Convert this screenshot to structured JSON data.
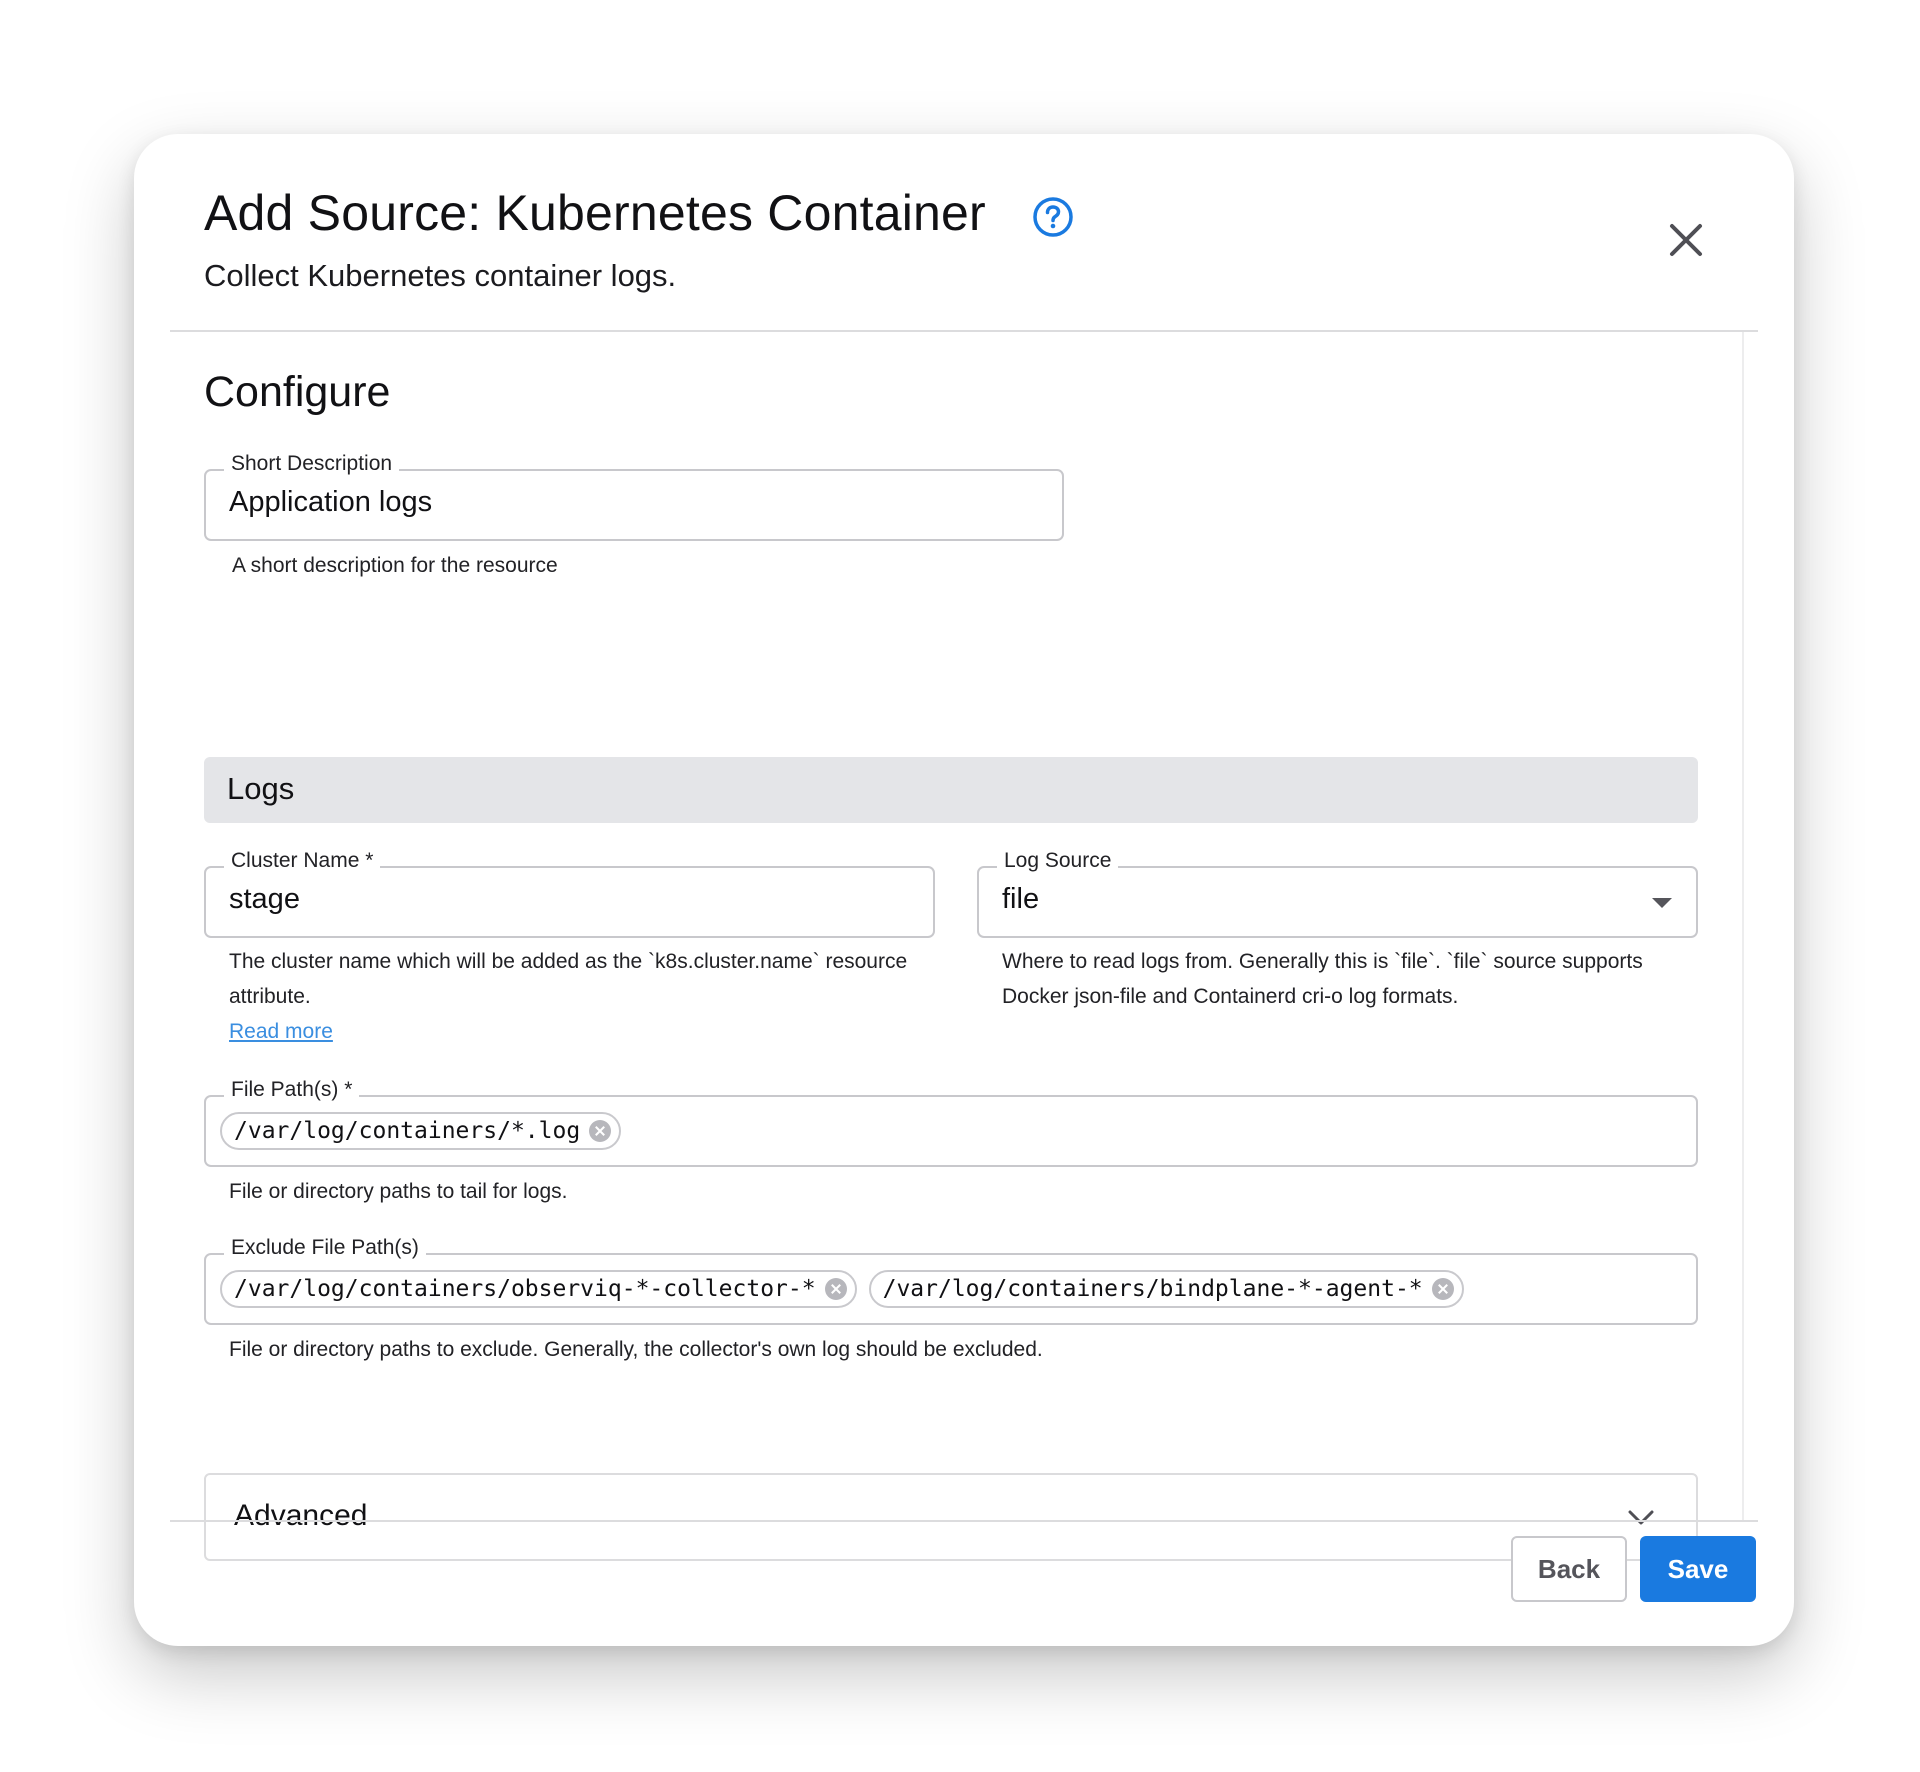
{
  "header": {
    "title": "Add Source: Kubernetes Container",
    "subtitle": "Collect Kubernetes container logs.",
    "help_icon": "question-circle-icon",
    "close_icon": "close-icon"
  },
  "configure": {
    "section_title": "Configure",
    "short_description": {
      "label": "Short Description",
      "value": "Application logs",
      "helper": "A short description for the resource"
    },
    "logs_section_title": "Logs",
    "cluster_name": {
      "label": "Cluster Name *",
      "value": "stage",
      "helper": "The cluster name which will be added as the `k8s.cluster.name` resource attribute.",
      "read_more": "Read more"
    },
    "log_source": {
      "label": "Log Source",
      "value": "file",
      "helper": "Where to read logs from. Generally this is `file`. `file` source supports Docker json-file and Containerd cri-o log formats."
    },
    "file_paths": {
      "label": "File Path(s) *",
      "chips": [
        "/var/log/containers/*.log"
      ],
      "helper": "File or directory paths to tail for logs."
    },
    "exclude_file_paths": {
      "label": "Exclude File Path(s)",
      "chips": [
        "/var/log/containers/observiq-*-collector-*",
        "/var/log/containers/bindplane-*-agent-*"
      ],
      "helper": "File or directory paths to exclude. Generally, the collector's own log should be excluded."
    },
    "advanced": {
      "label": "Advanced",
      "icon": "chevron-down-icon"
    }
  },
  "footer": {
    "back_label": "Back",
    "save_label": "Save"
  },
  "colors": {
    "accent": "#1a7ae0",
    "link": "#3a8ee0",
    "section_bar": "#e4e5e8"
  }
}
